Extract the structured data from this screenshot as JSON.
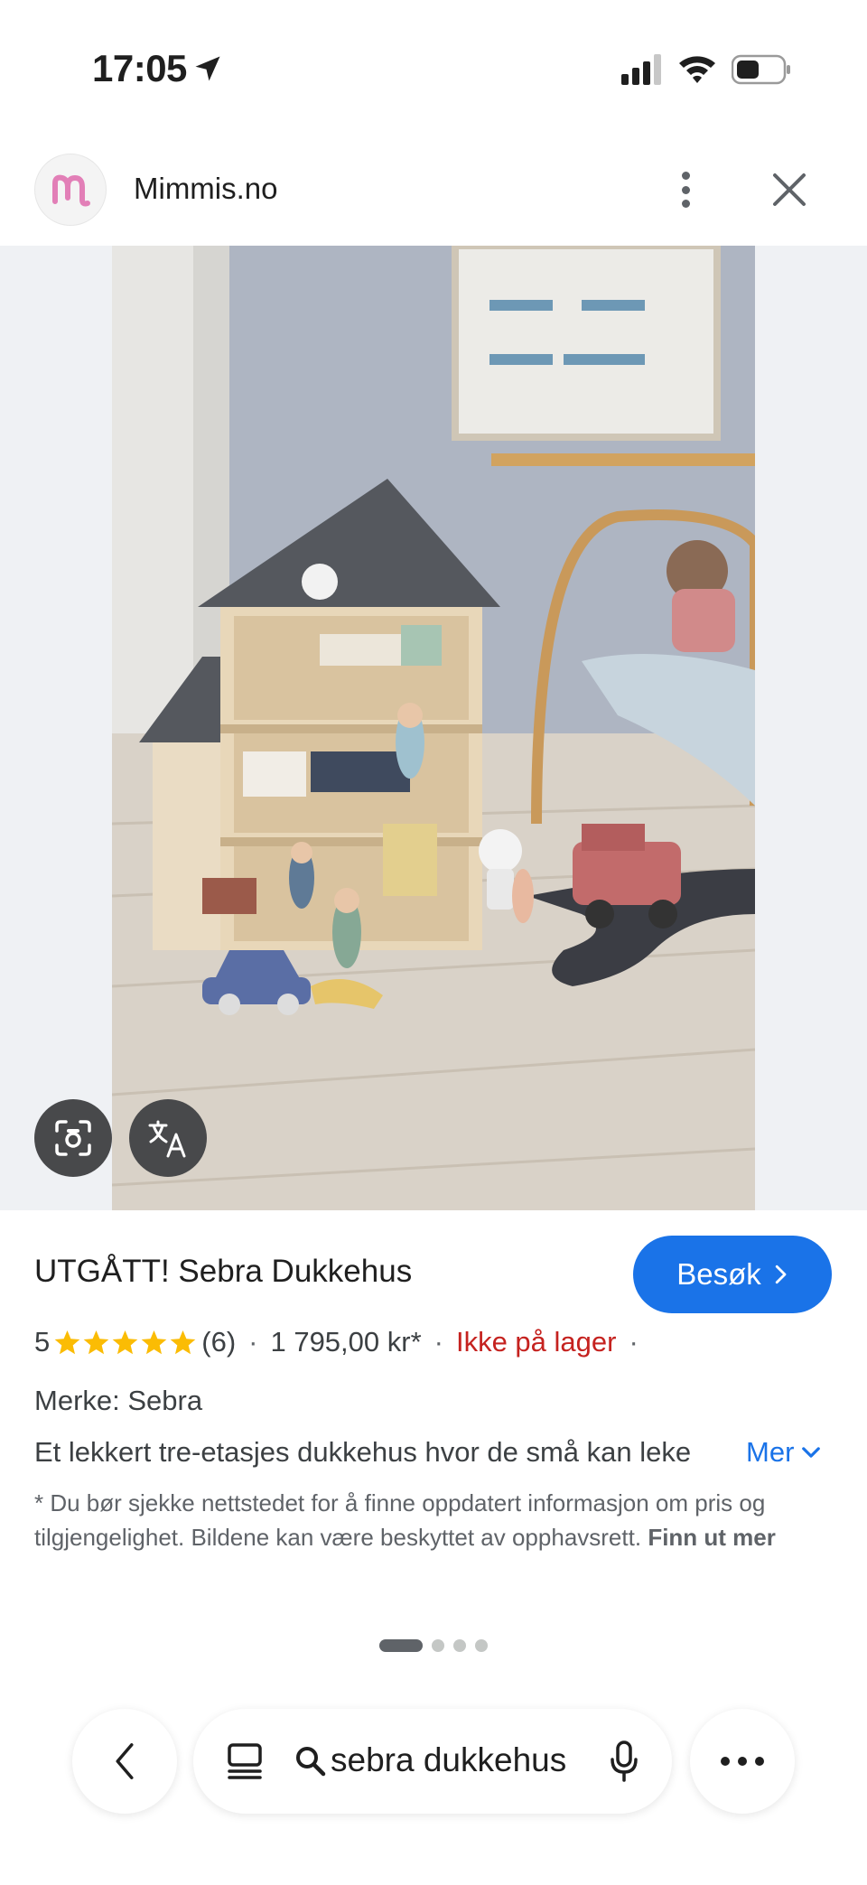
{
  "status_bar": {
    "time": "17:05"
  },
  "header": {
    "site_name": "Mimmis.no"
  },
  "product": {
    "title": "UTGÅTT! Sebra Dukkehus",
    "visit_label": "Besøk",
    "rating_value": "5",
    "rating_stars": 5,
    "rating_count": "(6)",
    "price": "1 795,00 kr*",
    "stock_status": "Ikke på lager",
    "brand": "Merke: Sebra",
    "description": "Et lekkert tre-etasjes dukkehus hvor de små kan leke",
    "more_label": "Mer",
    "disclaimer": "* Du bør sjekke nettstedet for å finne oppdatert informasjon om pris og tilgjengelighet. Bildene kan være beskyttet av opphavsrett.",
    "learn_more": "Finn ut mer"
  },
  "pager": {
    "total": 4,
    "active": 1
  },
  "search": {
    "query": "sebra dukkehus"
  },
  "colors": {
    "accent": "#1a73e8",
    "out_of_stock": "#c5221f",
    "star": "#fbbc04"
  },
  "icons": [
    "location-arrow-icon",
    "signal-icon",
    "wifi-icon",
    "battery-icon",
    "more-vert-icon",
    "close-icon",
    "lens-icon",
    "translate-icon",
    "chevron-right-icon",
    "star-icon",
    "chevron-down-icon",
    "back-icon",
    "tabs-icon",
    "search-icon",
    "mic-icon",
    "more-horiz-icon"
  ]
}
